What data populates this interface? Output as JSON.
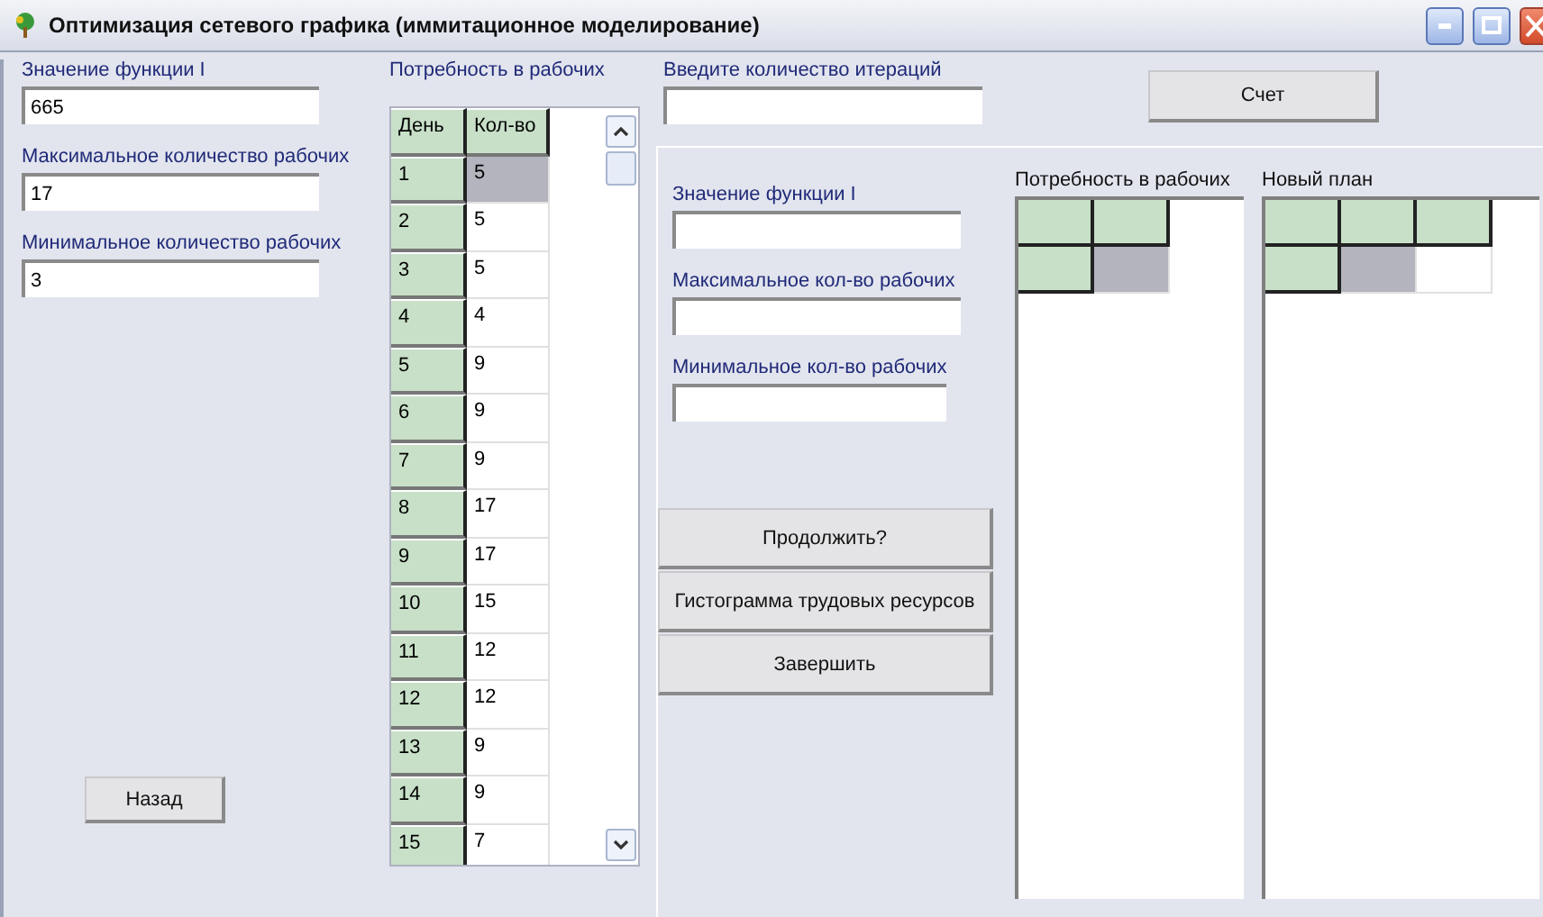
{
  "window": {
    "title": "Оптимизация сетевого графика (иммитационное моделирование)"
  },
  "left": {
    "fields": [
      {
        "label": "Значение функции I",
        "value": "665"
      },
      {
        "label": "Максимальное количество рабочих",
        "value": "17"
      },
      {
        "label": "Минимальное количество рабочих",
        "value": "3"
      }
    ],
    "back_button": "Назад",
    "demand": {
      "title": "Потребность в рабочих",
      "columns": [
        "День",
        "Кол-во"
      ],
      "rows": [
        {
          "day": "1",
          "count": "5",
          "selected": true
        },
        {
          "day": "2",
          "count": "5",
          "selected": false
        },
        {
          "day": "3",
          "count": "5",
          "selected": false
        },
        {
          "day": "4",
          "count": "4",
          "selected": false
        },
        {
          "day": "5",
          "count": "9",
          "selected": false
        },
        {
          "day": "6",
          "count": "9",
          "selected": false
        },
        {
          "day": "7",
          "count": "9",
          "selected": false
        },
        {
          "day": "8",
          "count": "17",
          "selected": false
        },
        {
          "day": "9",
          "count": "17",
          "selected": false
        },
        {
          "day": "10",
          "count": "15",
          "selected": false
        },
        {
          "day": "11",
          "count": "12",
          "selected": false
        },
        {
          "day": "12",
          "count": "12",
          "selected": false
        },
        {
          "day": "13",
          "count": "9",
          "selected": false
        },
        {
          "day": "14",
          "count": "9",
          "selected": false
        },
        {
          "day": "15",
          "count": "7",
          "selected": false
        }
      ]
    }
  },
  "right": {
    "iterations": {
      "label": "Введите количество итераций"
    },
    "calc_button": "Счет",
    "fields": [
      {
        "label": "Значение функции I"
      },
      {
        "label": "Максимальное кол-во рабочих"
      },
      {
        "label": "Минимальное кол-во рабочих"
      }
    ],
    "buttons": [
      "Продолжить?",
      "Гистограмма трудовых ресурсов",
      "Завершить"
    ],
    "grids": [
      {
        "title": "Потребность в рабочих",
        "cells": [
          [
            {
              "kind": "fixed"
            },
            {
              "kind": "fixed"
            }
          ],
          [
            {
              "kind": "fixed"
            },
            {
              "kind": "selected"
            }
          ]
        ]
      },
      {
        "title": "Новый план",
        "cells": [
          [
            {
              "kind": "fixed"
            },
            {
              "kind": "fixed"
            },
            {
              "kind": "fixed"
            }
          ],
          [
            {
              "kind": "fixed"
            },
            {
              "kind": "selected"
            },
            {
              "kind": "normal"
            }
          ]
        ]
      }
    ]
  }
}
